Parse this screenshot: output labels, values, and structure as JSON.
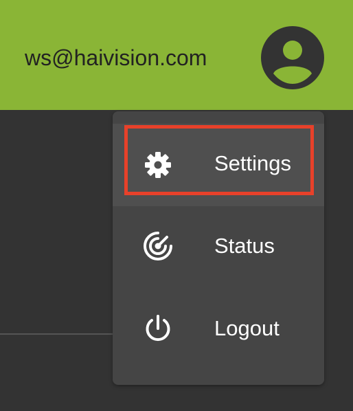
{
  "header": {
    "user_email": "ws@haivision.com",
    "avatar_icon": "account-circle-icon",
    "background_color": "#8ab536"
  },
  "menu": {
    "items": [
      {
        "label": "Settings",
        "icon": "gear-icon",
        "selected": true
      },
      {
        "label": "Status",
        "icon": "radar-icon",
        "selected": false
      },
      {
        "label": "Logout",
        "icon": "power-icon",
        "selected": false
      }
    ],
    "highlight_color": "#e8412a"
  }
}
